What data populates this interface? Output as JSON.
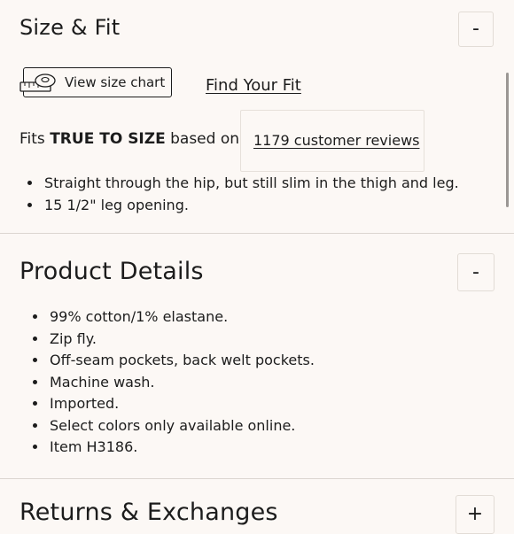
{
  "size_fit": {
    "title": "Size & Fit",
    "toggle": "-",
    "view_size_chart": "View size chart",
    "find_your_fit": "Find Your Fit",
    "fits_prefix": "Fits",
    "fits_value": "TRUE TO SIZE",
    "fits_suffix": "based on",
    "reviews_link": "1179 customer reviews",
    "bullets": [
      "Straight through the hip, but still slim in the thigh and leg.",
      "15 1/2\" leg opening."
    ]
  },
  "product_details": {
    "title": "Product Details",
    "toggle": "-",
    "bullets": [
      "99% cotton/1% elastane.",
      "Zip fly.",
      "Off-seam pockets, back welt pockets.",
      "Machine wash.",
      "Imported.",
      "Select colors only available online.",
      "Item H3186."
    ]
  },
  "returns": {
    "title": "Returns & Exchanges",
    "toggle": "+"
  },
  "colors": {
    "background": "#fcf8f5",
    "text": "#1c1c1c",
    "divider": "#dcd6d1"
  }
}
